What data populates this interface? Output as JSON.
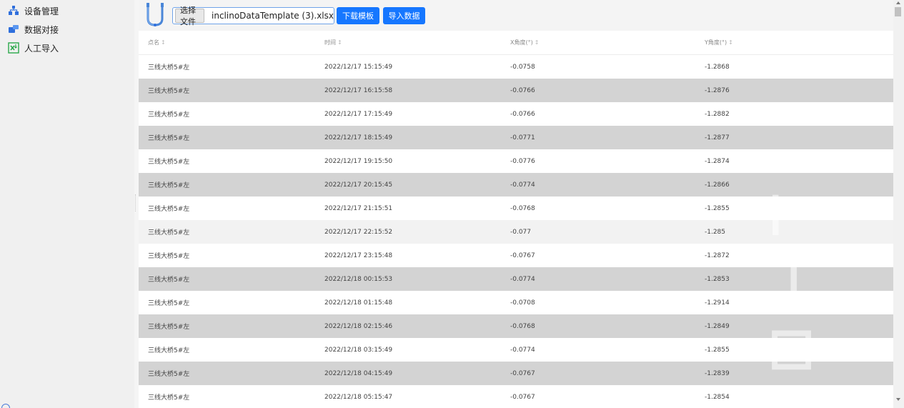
{
  "sidebar": {
    "items": [
      {
        "label": "设备管理",
        "icon": "network-icon"
      },
      {
        "label": "数据对接",
        "icon": "data-interface-icon"
      },
      {
        "label": "人工导入",
        "icon": "excel-import-icon"
      }
    ]
  },
  "toolbar": {
    "choose_label": "选择文件",
    "file_name": "inclinoDataTemplate (3).xlsx",
    "download_label": "下载模板",
    "import_label": "导入数据"
  },
  "table": {
    "headers": [
      "点名",
      "时间",
      "X角度(°)",
      "Y角度(°)"
    ],
    "rows": [
      {
        "point": "三线大桥5#左",
        "time": "2022/12/17 15:15:49",
        "x": "-0.0758",
        "y": "-1.2868"
      },
      {
        "point": "三线大桥5#左",
        "time": "2022/12/17 16:15:58",
        "x": "-0.0766",
        "y": "-1.2876"
      },
      {
        "point": "三线大桥5#左",
        "time": "2022/12/17 17:15:49",
        "x": "-0.0766",
        "y": "-1.2882"
      },
      {
        "point": "三线大桥5#左",
        "time": "2022/12/17 18:15:49",
        "x": "-0.0771",
        "y": "-1.2877"
      },
      {
        "point": "三线大桥5#左",
        "time": "2022/12/17 19:15:50",
        "x": "-0.0776",
        "y": "-1.2874"
      },
      {
        "point": "三线大桥5#左",
        "time": "2022/12/17 20:15:45",
        "x": "-0.0774",
        "y": "-1.2866"
      },
      {
        "point": "三线大桥5#左",
        "time": "2022/12/17 21:15:51",
        "x": "-0.0768",
        "y": "-1.2855"
      },
      {
        "point": "三线大桥5#左",
        "time": "2022/12/17 22:15:52",
        "x": "-0.077",
        "y": "-1.285"
      },
      {
        "point": "三线大桥5#左",
        "time": "2022/12/17 23:15:48",
        "x": "-0.0767",
        "y": "-1.2872"
      },
      {
        "point": "三线大桥5#左",
        "time": "2022/12/18 00:15:53",
        "x": "-0.0774",
        "y": "-1.2853"
      },
      {
        "point": "三线大桥5#左",
        "time": "2022/12/18 01:15:48",
        "x": "-0.0708",
        "y": "-1.2914"
      },
      {
        "point": "三线大桥5#左",
        "time": "2022/12/18 02:15:46",
        "x": "-0.0768",
        "y": "-1.2849"
      },
      {
        "point": "三线大桥5#左",
        "time": "2022/12/18 03:15:49",
        "x": "-0.0774",
        "y": "-1.2855"
      },
      {
        "point": "三线大桥5#左",
        "time": "2022/12/18 04:15:49",
        "x": "-0.0767",
        "y": "-1.2839"
      },
      {
        "point": "三线大桥5#左",
        "time": "2022/12/18 05:15:47",
        "x": "-0.0767",
        "y": "-1.2854"
      }
    ]
  },
  "colors": {
    "accent": "#1677ff",
    "row_alt": "#d3d3d3",
    "sidebar_bg": "#f0f0f0"
  }
}
